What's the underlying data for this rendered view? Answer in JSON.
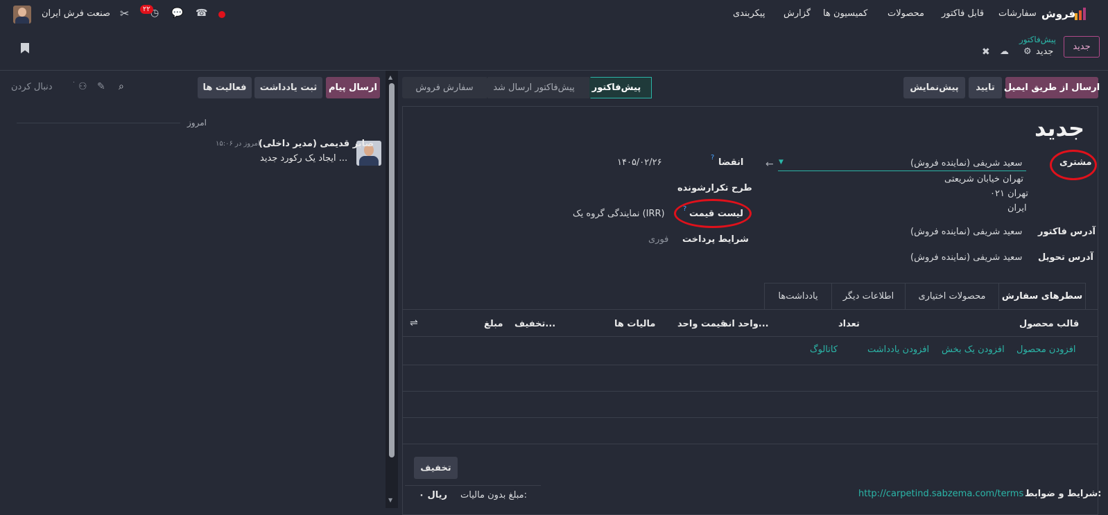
{
  "top": {
    "app_name": "فروش",
    "menu": [
      "سفارشات",
      "قابل فاکتور",
      "محصولات",
      "کمیسیون ها",
      "گزارش",
      "پیکربندی"
    ],
    "company": "صنعت فرش ایران",
    "badge": "۲۲"
  },
  "breadcrumb": {
    "parent": "پیش‌فاکتور",
    "current": "جدید",
    "new_button": "جدید"
  },
  "actions": {
    "send_email": "ارسال از طریق ایمیل",
    "confirm": "تایید",
    "preview": "پیش‌نمایش"
  },
  "stages": [
    "پیش‌فاکتور",
    "پیش‌فاکتور ارسال شد",
    "سفارش فروش"
  ],
  "chatter": {
    "send_message": "ارسال پیام",
    "log_note": "ثبت یادداشت",
    "activities": "فعالیت ها",
    "follow": "دنبال کردن",
    "follower_count": "۰",
    "day_label": "امروز",
    "message": {
      "author": "صابر قدیمی (مدیر داخلی)",
      "time": "امروز در ۱۵:۰۶",
      "body": "ایجاد یک رکورد جدید ..."
    }
  },
  "form": {
    "title": "جدید",
    "customer_label": "مشتری",
    "customer_value": "سعید شریفی (نماینده فروش)",
    "address": [
      "تهران خیابان شریعتی",
      "تهران ۰۲۱",
      "ایران"
    ],
    "invoice_addr_label": "آدرس فاکتور",
    "invoice_addr_value": "سعید شریفی (نماینده فروش)",
    "delivery_addr_label": "آدرس تحویل",
    "delivery_addr_value": "سعید شریفی (نماینده فروش)",
    "expiry_label": "انقضا",
    "expiry_value": "۱۴۰۵/۰۲/۲۶",
    "recurring_label": "طرح تکرارشونده",
    "pricelist_label": "لیست قیمت",
    "pricelist_value": "نمایندگی گروه یک (IRR)",
    "payment_terms_label": "شرایط پرداخت",
    "payment_terms_value": "فوری",
    "help_mark": "?"
  },
  "tabs": [
    "سطرهای سفارش",
    "محصولات اختیاری",
    "اطلاعات دیگر",
    "یادداشت‌ها"
  ],
  "table": {
    "headers": [
      "قالب محصول",
      "تعداد",
      "واحد اند...",
      "قیمت واحد",
      "مالیات ها",
      "تخفیف...",
      "مبلغ"
    ],
    "links": [
      "افزودن محصول",
      "افزودن یک بخش",
      "افزودن یادداشت",
      "کاتالوگ"
    ]
  },
  "footer": {
    "discount_button": "تخفیف",
    "terms_label": "شرایط و ضوابط:",
    "terms_url": "http://carpetind.sabzema.com/terms",
    "untaxed_label": "مبلغ بدون مالیات:",
    "untaxed_value": "ریال ۰"
  },
  "colors": {
    "primary": "#71405f",
    "accent": "#2bb6a8",
    "highlight": "#e0111b"
  }
}
